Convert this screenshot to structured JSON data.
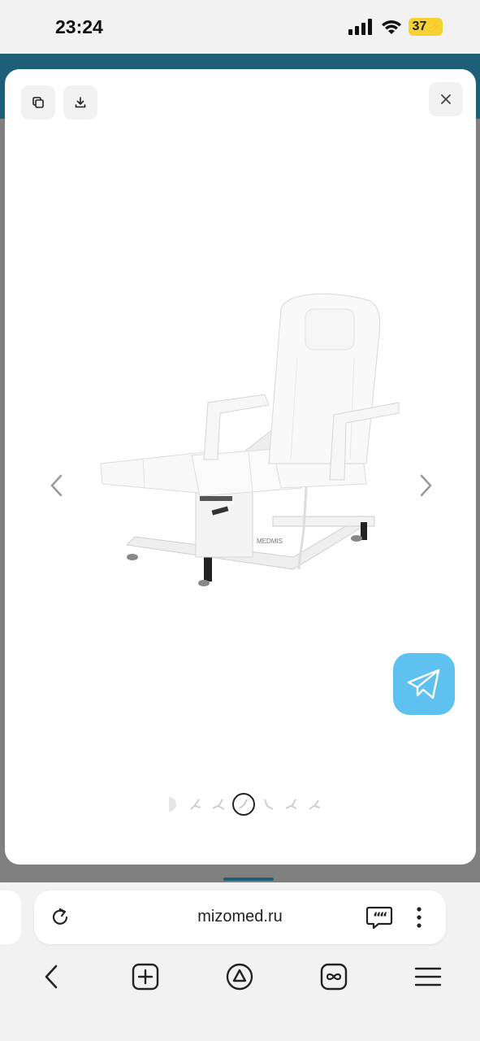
{
  "status_bar": {
    "time": "23:24",
    "battery": "37",
    "signal_icon": "cellular-signal-icon",
    "wifi_icon": "wifi-icon"
  },
  "modal": {
    "buttons": {
      "copy_icon": "copy-icon",
      "download_icon": "download-icon",
      "close_icon": "close-icon"
    },
    "image": {
      "brand_label": "MEDMIS"
    },
    "gallery": {
      "thumbnail_count": 7,
      "active_index": 4
    },
    "telegram_icon": "telegram-icon"
  },
  "browser": {
    "url": "mizomed.ru",
    "icons": [
      "reload-icon",
      "quote-icon",
      "more-icon",
      "back-icon",
      "new-tab-icon",
      "alice-icon",
      "tabs-icon",
      "menu-icon"
    ]
  },
  "colors": {
    "header_teal": "#1d5f78",
    "telegram_blue": "#5ec1ef",
    "battery_yellow": "#f5d232"
  }
}
